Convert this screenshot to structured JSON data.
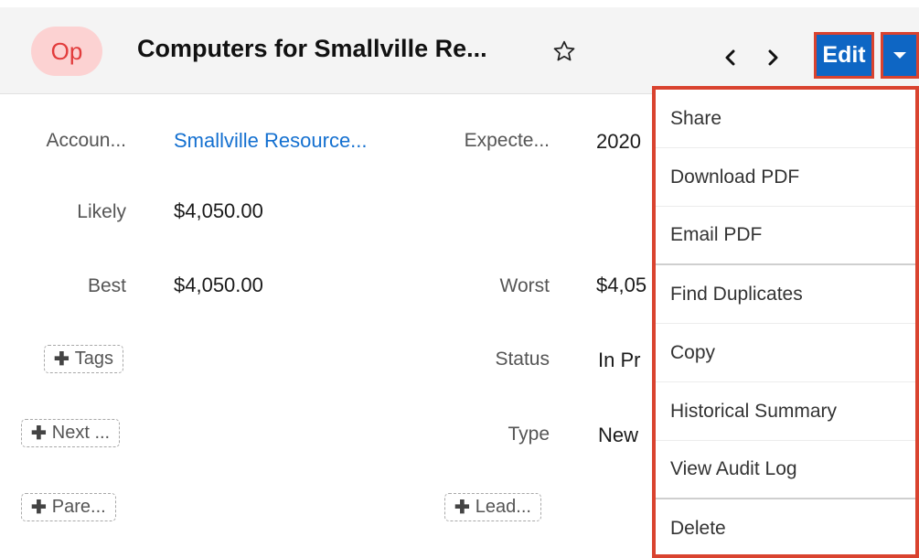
{
  "header": {
    "avatar_text": "Op",
    "title": "Computers for Smallville Re...",
    "edit_label": "Edit",
    "avatar_color": "#fcd2d2",
    "accent_color": "#0e66c4"
  },
  "fields": {
    "account": {
      "label": "Accoun...",
      "value": "Smallville Resource..."
    },
    "expected": {
      "label": "Expecte...",
      "value": "2020"
    },
    "likely": {
      "label": "Likely",
      "value": "$4,050.00"
    },
    "best": {
      "label": "Best",
      "value": "$4,050.00"
    },
    "worst": {
      "label": "Worst",
      "value": "$4,05"
    },
    "status": {
      "label": "Status",
      "value": "In Pr"
    },
    "type": {
      "label": "Type",
      "value": "New"
    }
  },
  "add_buttons": {
    "tags": "Tags",
    "next": "Next ...",
    "parent": "Pare...",
    "lead": "Lead..."
  },
  "menu": {
    "items": [
      {
        "label": "Share"
      },
      {
        "label": "Download PDF"
      },
      {
        "label": "Email PDF"
      },
      {
        "label": "Find Duplicates"
      },
      {
        "label": "Copy"
      },
      {
        "label": "Historical Summary"
      },
      {
        "label": "View Audit Log"
      },
      {
        "label": "Delete"
      }
    ]
  },
  "icons": {
    "favorite": "star-outline-icon",
    "prev": "chevron-left-icon",
    "next": "chevron-right-icon",
    "actions": "caret-down-icon",
    "add": "plus-icon"
  },
  "highlight_color": "#d9432f"
}
